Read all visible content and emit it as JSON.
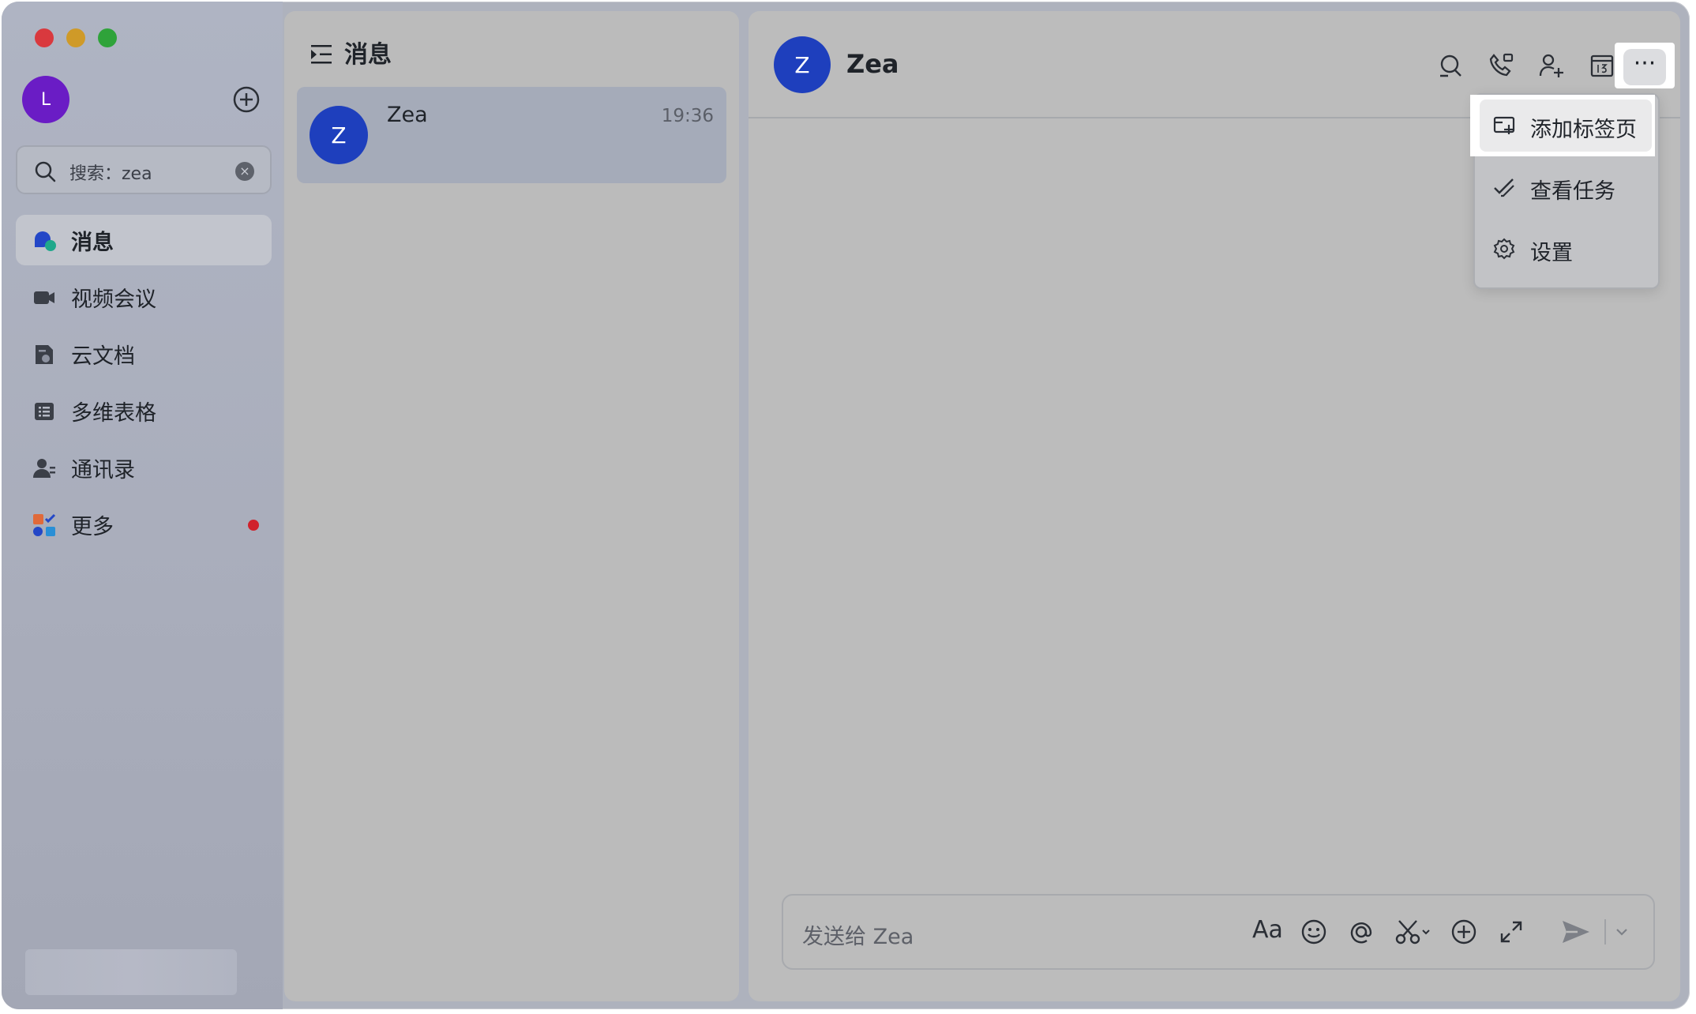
{
  "window": {
    "controls": [
      "close",
      "minimize",
      "maximize"
    ]
  },
  "user": {
    "avatar_letter": "L",
    "avatar_color": "#6a1cc5"
  },
  "search": {
    "text": "搜索：zea",
    "clear_glyph": "×"
  },
  "nav": {
    "items": [
      {
        "label": "消息",
        "icon": "message-icon",
        "active": true
      },
      {
        "label": "视频会议",
        "icon": "video-meeting-icon"
      },
      {
        "label": "云文档",
        "icon": "cloud-doc-icon"
      },
      {
        "label": "多维表格",
        "icon": "base-table-icon"
      },
      {
        "label": "通讯录",
        "icon": "contacts-icon"
      },
      {
        "label": "更多",
        "icon": "more-apps-icon",
        "badge": "red-dot"
      }
    ]
  },
  "list": {
    "title": "消息",
    "conversations": [
      {
        "avatar_letter": "Z",
        "name": "Zea",
        "time": "19:36"
      }
    ]
  },
  "chat": {
    "avatar_letter": "Z",
    "avatar_color": "#1e3fbd",
    "name": "Zea",
    "header_icons": [
      "search-chat-icon",
      "call-icon",
      "add-member-icon",
      "calendar-icon",
      "more-icon"
    ],
    "more_glyph": "···",
    "menu": [
      {
        "label": "添加标签页",
        "icon": "add-tab-icon"
      },
      {
        "label": "查看任务",
        "icon": "task-check-icon"
      },
      {
        "label": "设置",
        "icon": "settings-gear-icon"
      }
    ],
    "composer": {
      "placeholder": "发送给 Zea",
      "format_glyph": "Aa",
      "tools": [
        "format-icon",
        "emoji-icon",
        "mention-icon",
        "screenshot-icon",
        "add-icon",
        "expand-icon",
        "send-icon",
        "send-options-icon"
      ]
    }
  },
  "colors": {
    "accent": "#1e3fbd",
    "badge": "#d0212b",
    "highlight": "#ffffff"
  }
}
